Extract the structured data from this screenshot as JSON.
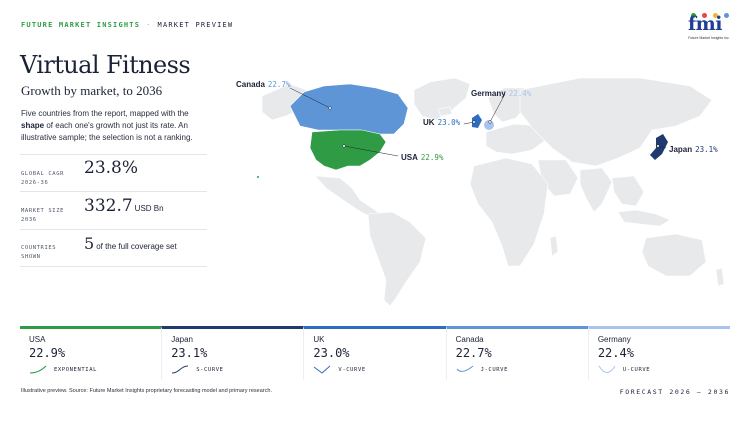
{
  "header": {
    "brand": "FUTURE MARKET INSIGHTS",
    "separator": "·",
    "section": "MARKET PREVIEW",
    "logo_text": "fmi",
    "logo_sub": "Future Market Insights Inc."
  },
  "title": "Virtual Fitness",
  "subtitle": "Growth by market, to 2036",
  "description": {
    "pre": "Five countries from the report, mapped with the ",
    "bold": "shape",
    "post": " of each one's growth not just its rate. An illustrative sample; the selection is not a ranking."
  },
  "stats": [
    {
      "label1": "GLOBAL CAGR",
      "label2": "2026-36",
      "value": "23.8%",
      "unit": ""
    },
    {
      "label1": "MARKET SIZE",
      "label2": "2036",
      "value": "332.7",
      "unit": "USD Bn"
    },
    {
      "label1": "COUNTRIES",
      "label2": "SHOWN",
      "value": "5",
      "unit": "of the full coverage set"
    }
  ],
  "map_labels": [
    {
      "country": "Canada",
      "value": "22.7%"
    },
    {
      "country": "Germany",
      "value": "22.4%"
    },
    {
      "country": "UK",
      "value": "23.0%"
    },
    {
      "country": "USA",
      "value": "22.9%"
    },
    {
      "country": "Japan",
      "value": "23.1%"
    }
  ],
  "cards": [
    {
      "country": "USA",
      "value": "22.9%",
      "shape": "EXPONENTIAL",
      "color": "#2f9c45"
    },
    {
      "country": "Japan",
      "value": "23.1%",
      "shape": "S-CURVE",
      "color": "#1f3a6e"
    },
    {
      "country": "UK",
      "value": "23.0%",
      "shape": "V-CURVE",
      "color": "#2d6cc0"
    },
    {
      "country": "Canada",
      "value": "22.7%",
      "shape": "J-CURVE",
      "color": "#5e95d6"
    },
    {
      "country": "Germany",
      "value": "22.4%",
      "shape": "U-CURVE",
      "color": "#a9c4ec"
    }
  ],
  "footer": {
    "note": "Illustrative preview. Source: Future Market Insights proprietary forecasting model and primary research.",
    "forecast": "FORECAST 2026 – 2036"
  },
  "colors": {
    "land": "#e8e9eb",
    "usa": "#2f9c45",
    "canada": "#5e95d6",
    "uk": "#2d6cc0",
    "germany": "#a9c4ec",
    "japan": "#1f3a6e",
    "brand_green": "#2f9c45",
    "logo_blue": "#1f3f94"
  }
}
